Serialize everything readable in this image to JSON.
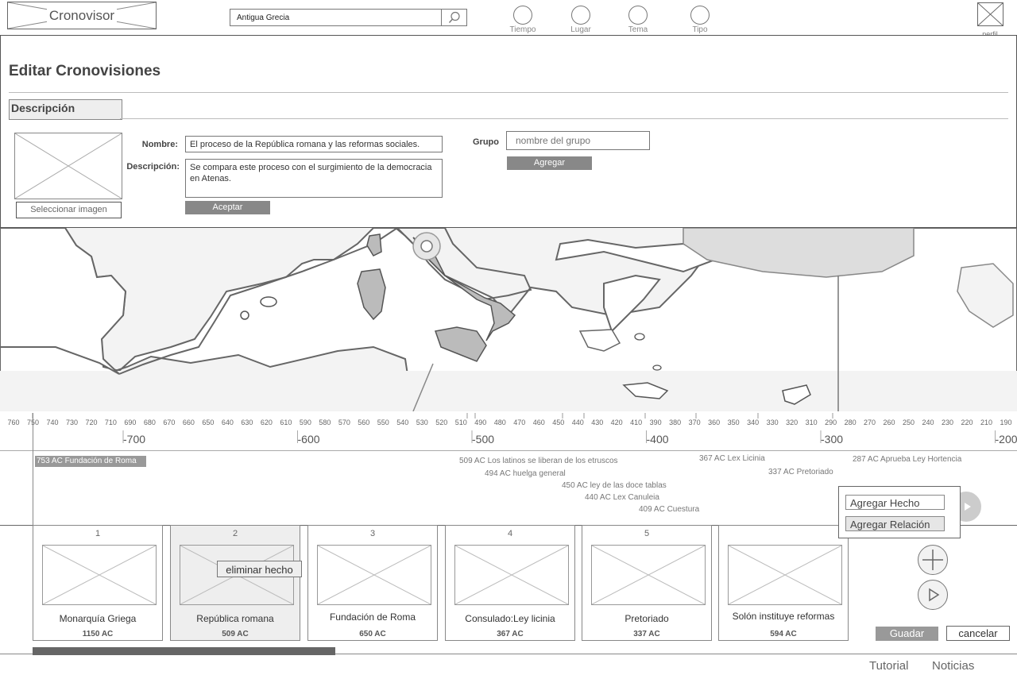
{
  "header": {
    "logo": "Cronovisor",
    "search": {
      "value": "Antigua Grecia",
      "placeholder": ""
    },
    "filters": [
      "Tiempo",
      "Lugar",
      "Tema",
      "Tipo"
    ],
    "profile_label": "perfil"
  },
  "edit_panel": {
    "title": "Editar Cronovisiones",
    "tab": "Descripción",
    "select_image": "Seleccionar imagen",
    "name_label": "Nombre:",
    "name_value": "El proceso de la República romana y las reformas sociales.",
    "desc_label": "Descripción:",
    "desc_value": "Se compara este proceso con el surgimiento de la democracia en Atenas.",
    "accept": "Aceptar",
    "group_label": "Grupo",
    "group_placeholder": "nombre del grupo",
    "add_group": "Agregar"
  },
  "timeline": {
    "minor_ticks": [
      "760",
      "750",
      "740",
      "730",
      "720",
      "710",
      "690",
      "680",
      "670",
      "660",
      "650",
      "640",
      "630",
      "620",
      "610",
      "590",
      "580",
      "570",
      "560",
      "550",
      "540",
      "530",
      "520",
      "510",
      "490",
      "480",
      "470",
      "460",
      "450",
      "440",
      "430",
      "420",
      "410",
      "390",
      "380",
      "370",
      "360",
      "350",
      "340",
      "330",
      "320",
      "310",
      "290",
      "280",
      "270",
      "260",
      "250",
      "240",
      "230",
      "220",
      "210",
      "190"
    ],
    "major_ticks": [
      "-700",
      "-600",
      "-500",
      "-400",
      "-300",
      "-200"
    ],
    "selected_event": "753 AC Fundación de Roma",
    "events": [
      "509 AC Los latinos se liberan de los etruscos",
      "494 AC huelga general",
      "450 AC ley de las doce tablas",
      "440 AC Lex Canuleia",
      "409 AC Cuestura",
      "367 AC Lex Licinia",
      "337 AC Pretoriado",
      "287 AC Aprueba Ley Hortencia"
    ]
  },
  "cards": [
    {
      "num": "1",
      "name": "Monarquía Griega",
      "date": "1150 AC"
    },
    {
      "num": "2",
      "name": "República romana",
      "date": "509 AC"
    },
    {
      "num": "3",
      "name": "Fundación de Roma",
      "date": "650 AC"
    },
    {
      "num": "4",
      "name": "Consulado:Ley licinia",
      "date": "367 AC"
    },
    {
      "num": "5",
      "name": "Pretoriado",
      "date": "337 AC"
    },
    {
      "num": "",
      "name": "Solón instituye reformas",
      "date": "594 AC"
    }
  ],
  "context_menu": "eliminar hecho",
  "add_menu": {
    "add_fact": "Agregar Hecho",
    "add_relation": "Agregar Relación"
  },
  "actions": {
    "save": "Guadar",
    "cancel": "cancelar"
  },
  "footer": {
    "tutorial": "Tutorial",
    "news": "Noticias"
  }
}
